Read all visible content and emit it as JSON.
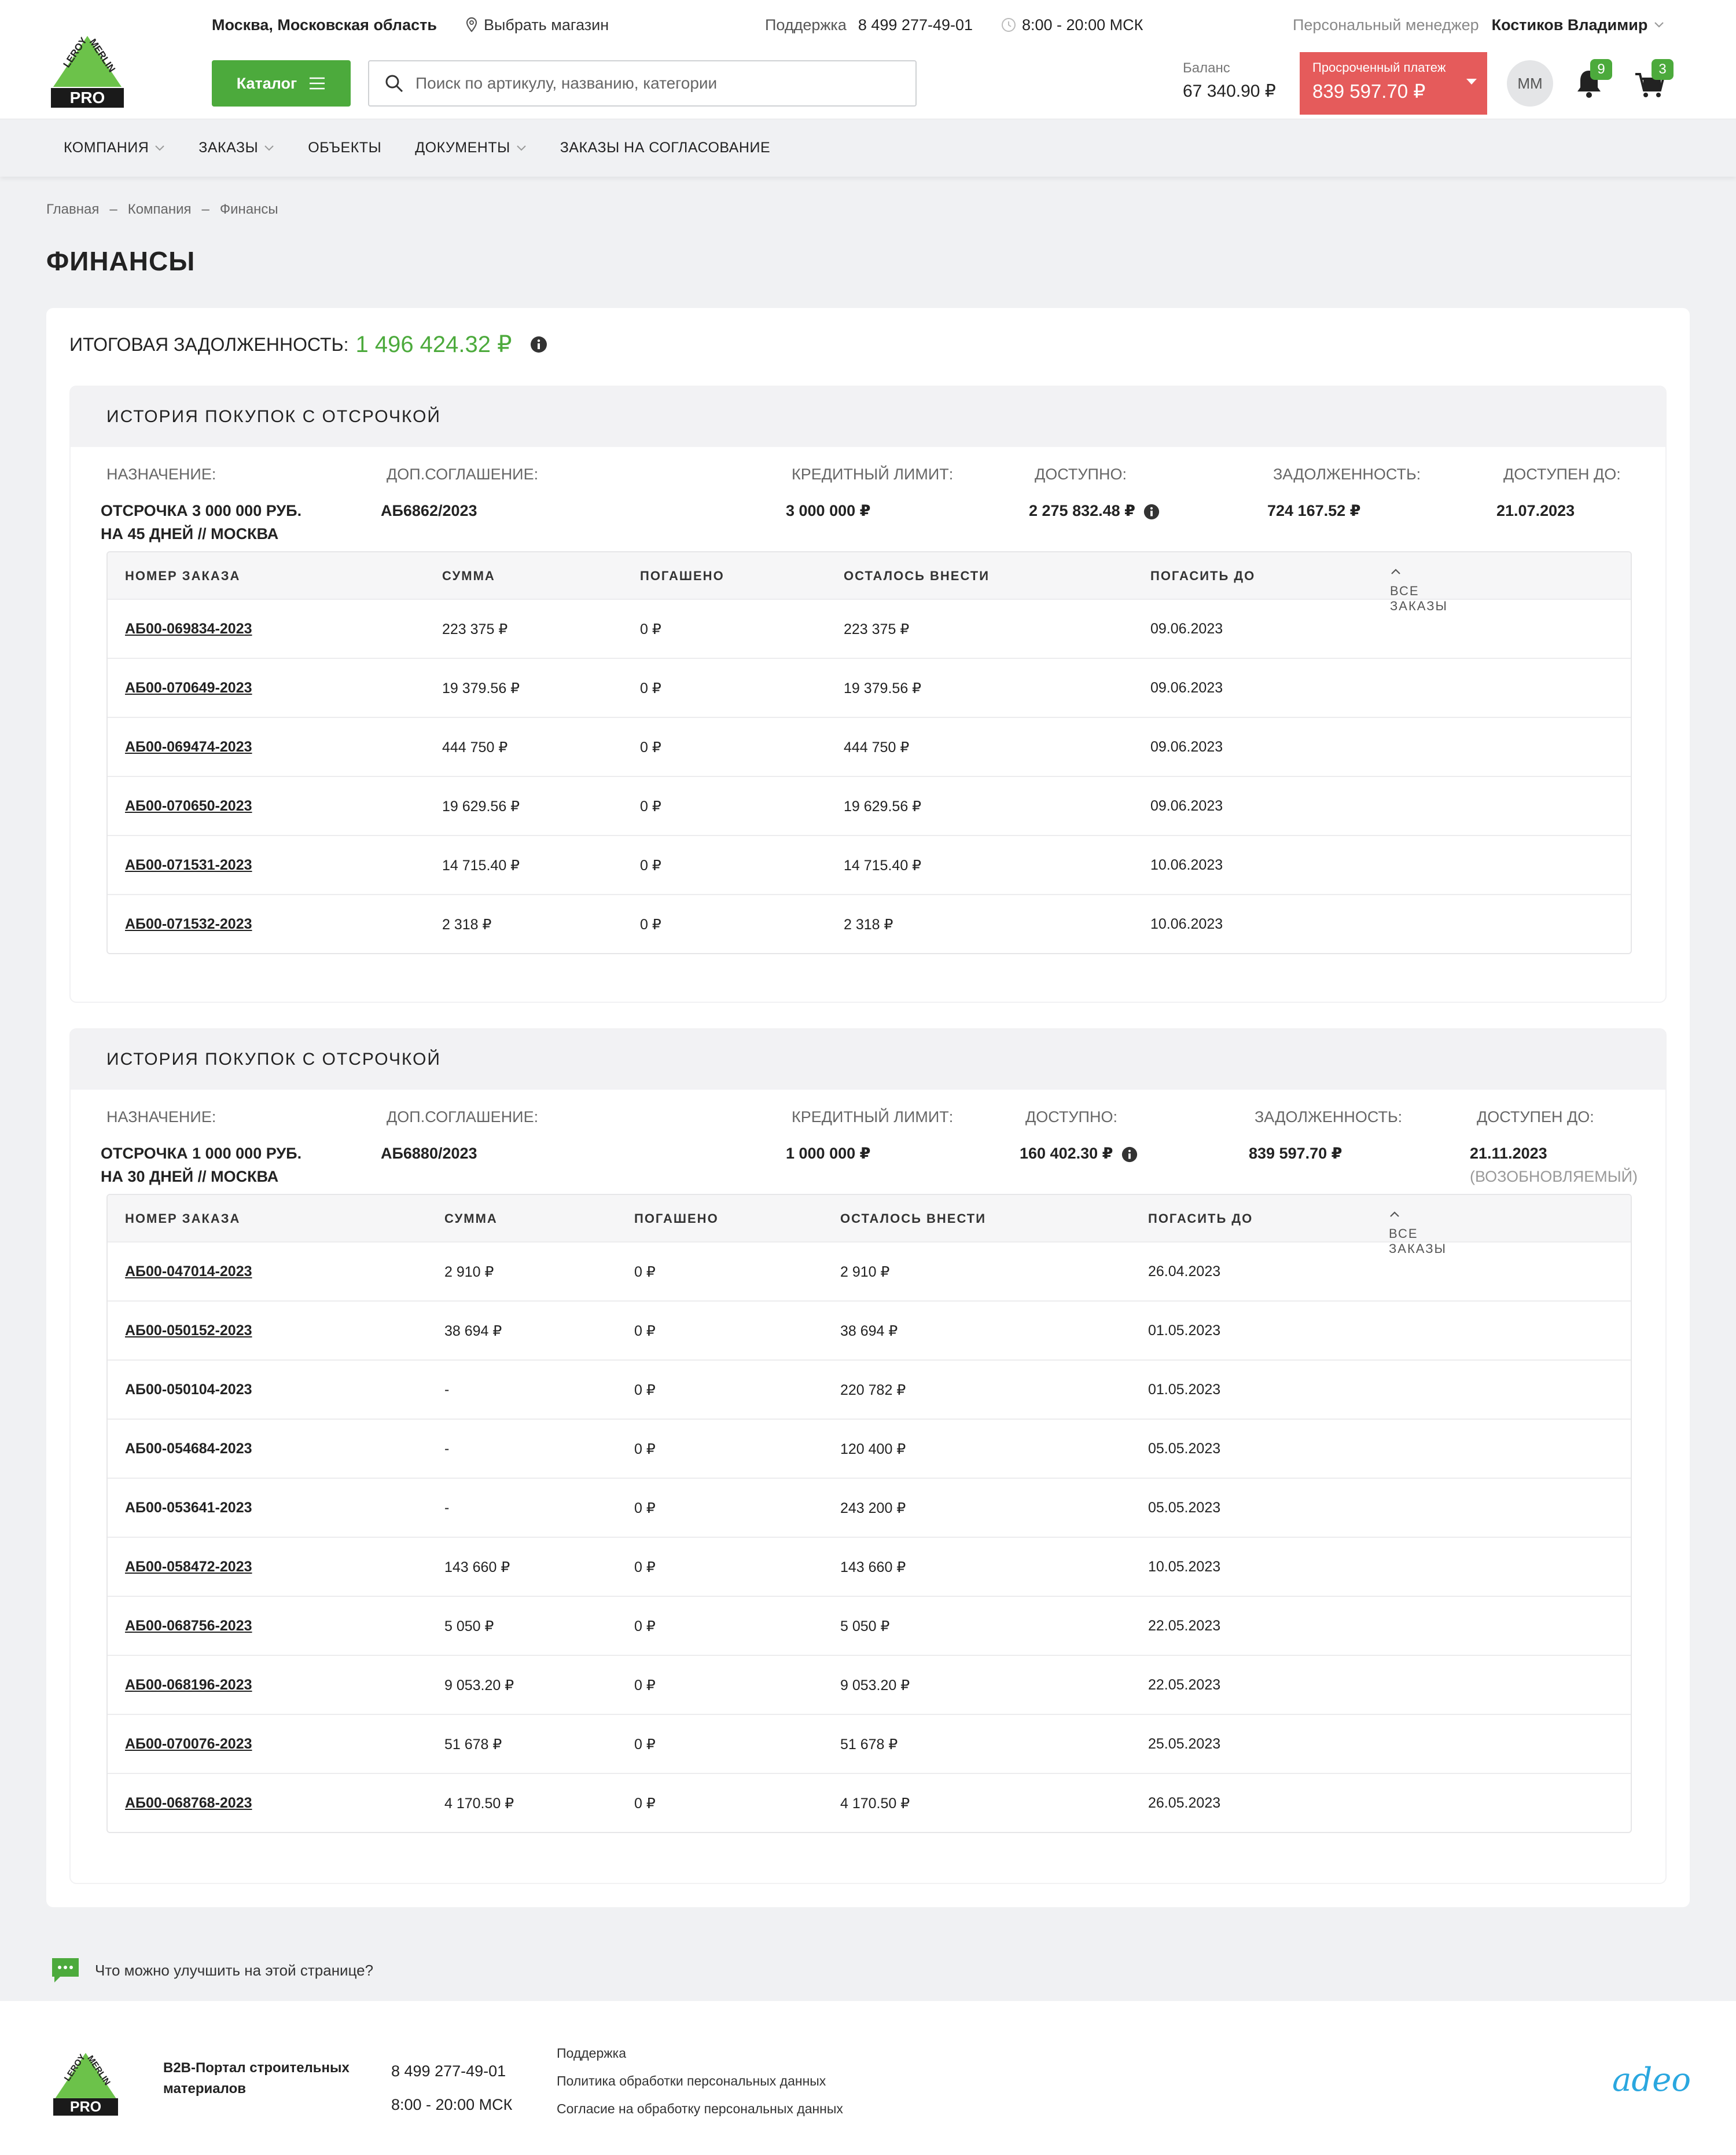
{
  "header": {
    "city": "Москва, Московская область",
    "store_label": "Выбрать магазин",
    "support_label": "Поддержка",
    "support_phone": "8 499 277-49-01",
    "hours": "8:00 - 20:00 МСК",
    "manager_label": "Персональный менеджер",
    "manager_name": "Костиков Владимир",
    "catalog_label": "Каталог",
    "search_placeholder": "Поиск по артикулу, названию, категории",
    "balance_label": "Баланс",
    "balance_value": "67 340.90 ₽",
    "overdue_label": "Просроченный платеж",
    "overdue_value": "839 597.70 ₽",
    "avatar_initials": "ММ",
    "notifications_count": "9",
    "cart_count": "3",
    "logo_text": "LEROY MERLIN",
    "logo_pro": "PRO"
  },
  "nav": {
    "items": [
      {
        "label": "КОМПАНИЯ"
      },
      {
        "label": "ЗАКАЗЫ"
      },
      {
        "label": "ОБЪЕКТЫ"
      },
      {
        "label": "ДОКУМЕНТЫ"
      },
      {
        "label": "ЗАКАЗЫ НА СОГЛАСОВАНИЕ"
      }
    ]
  },
  "breadcrumb": [
    "Главная",
    "Компания",
    "Финансы"
  ],
  "breadcrumb_sep": "–",
  "page_title": "ФИНАНСЫ",
  "total": {
    "label": "ИТОГОВАЯ ЗАДОЛЖЕННОСТЬ:",
    "amount": "1 496 424.32 ₽"
  },
  "labels": {
    "purpose": "НАЗНАЧЕНИЕ:",
    "agreement": "ДОП.СОГЛАШЕНИЕ:",
    "credit_limit": "КРЕДИТНЫЙ ЛИМИТ:",
    "available": "ДОСТУПНО:",
    "debt": "ЗАДОЛЖЕННОСТЬ:",
    "available_until": "ДОСТУПЕН ДО:",
    "col_order": "НОМЕР ЗАКАЗА",
    "col_sum": "СУММА",
    "col_paid": "ПОГАШЕНО",
    "col_remaining": "ОСТАЛОСЬ ВНЕСТИ",
    "col_due": "ПОГАСИТЬ ДО",
    "all_orders": "ВСЕ ЗАКАЗЫ"
  },
  "sections": [
    {
      "title": "ИСТОРИЯ ПОКУПОК С ОТСРОЧКОЙ",
      "purpose_line1": "ОТСРОЧКА 3 000 000 РУБ.",
      "purpose_line2": "НА 45 ДНЕЙ // МОСКВА",
      "agreement": "АБ6862/2023",
      "credit_limit": "3 000 000 ₽",
      "available": "2 275 832.48 ₽",
      "debt": "724 167.52 ₽",
      "available_until": "21.07.2023",
      "available_until_note": "",
      "orders": [
        {
          "num": "АБ00-069834-2023",
          "link": true,
          "sum": "223 375 ₽",
          "paid": "0 ₽",
          "remaining": "223 375 ₽",
          "due": "09.06.2023"
        },
        {
          "num": "АБ00-070649-2023",
          "link": true,
          "sum": "19 379.56 ₽",
          "paid": "0 ₽",
          "remaining": "19 379.56 ₽",
          "due": "09.06.2023"
        },
        {
          "num": "АБ00-069474-2023",
          "link": true,
          "sum": "444 750 ₽",
          "paid": "0 ₽",
          "remaining": "444 750 ₽",
          "due": "09.06.2023"
        },
        {
          "num": "АБ00-070650-2023",
          "link": true,
          "sum": "19 629.56 ₽",
          "paid": "0 ₽",
          "remaining": "19 629.56 ₽",
          "due": "09.06.2023"
        },
        {
          "num": "АБ00-071531-2023",
          "link": true,
          "sum": "14 715.40 ₽",
          "paid": "0 ₽",
          "remaining": "14 715.40 ₽",
          "due": "10.06.2023"
        },
        {
          "num": "АБ00-071532-2023",
          "link": true,
          "sum": "2 318 ₽",
          "paid": "0 ₽",
          "remaining": "2 318 ₽",
          "due": "10.06.2023"
        }
      ]
    },
    {
      "title": "ИСТОРИЯ ПОКУПОК С ОТСРОЧКОЙ",
      "purpose_line1": "ОТСРОЧКА 1 000 000 РУБ.",
      "purpose_line2": "НА 30 ДНЕЙ // МОСКВА",
      "agreement": "АБ6880/2023",
      "credit_limit": "1 000 000 ₽",
      "available": "160 402.30 ₽",
      "debt": "839 597.70 ₽",
      "available_until": "21.11.2023",
      "available_until_note": "(ВОЗОБНОВЛЯЕМЫЙ)",
      "orders": [
        {
          "num": "АБ00-047014-2023",
          "link": true,
          "sum": "2 910 ₽",
          "paid": "0 ₽",
          "remaining": "2 910 ₽",
          "due": "26.04.2023"
        },
        {
          "num": "АБ00-050152-2023",
          "link": true,
          "sum": "38 694 ₽",
          "paid": "0 ₽",
          "remaining": "38 694 ₽",
          "due": "01.05.2023"
        },
        {
          "num": "АБ00-050104-2023",
          "link": false,
          "sum": "-",
          "paid": "0 ₽",
          "remaining": "220 782 ₽",
          "due": "01.05.2023"
        },
        {
          "num": "АБ00-054684-2023",
          "link": false,
          "sum": "-",
          "paid": "0 ₽",
          "remaining": "120 400 ₽",
          "due": "05.05.2023"
        },
        {
          "num": "АБ00-053641-2023",
          "link": false,
          "sum": "-",
          "paid": "0 ₽",
          "remaining": "243 200 ₽",
          "due": "05.05.2023"
        },
        {
          "num": "АБ00-058472-2023",
          "link": true,
          "sum": "143 660 ₽",
          "paid": "0 ₽",
          "remaining": "143 660 ₽",
          "due": "10.05.2023"
        },
        {
          "num": "АБ00-068756-2023",
          "link": true,
          "sum": "5 050 ₽",
          "paid": "0 ₽",
          "remaining": "5 050 ₽",
          "due": "22.05.2023"
        },
        {
          "num": "АБ00-068196-2023",
          "link": true,
          "sum": "9 053.20 ₽",
          "paid": "0 ₽",
          "remaining": "9 053.20 ₽",
          "due": "22.05.2023"
        },
        {
          "num": "АБ00-070076-2023",
          "link": true,
          "sum": "51 678 ₽",
          "paid": "0 ₽",
          "remaining": "51 678 ₽",
          "due": "25.05.2023"
        },
        {
          "num": "АБ00-068768-2023",
          "link": true,
          "sum": "4 170.50 ₽",
          "paid": "0 ₽",
          "remaining": "4 170.50 ₽",
          "due": "26.05.2023"
        }
      ]
    }
  ],
  "feedback": "Что можно улучшить на этой странице?",
  "footer": {
    "title_line1": "B2B-Портал строительных",
    "title_line2": "материалов",
    "phone": "8 499 277-49-01",
    "hours": "8:00 - 20:00 МСК",
    "links": [
      "Поддержка",
      "Политика обработки персональных данных",
      "Согласие на обработку персональных данных"
    ],
    "brand": "adeo"
  },
  "colors": {
    "accent_green": "#4caa3c",
    "overdue_red": "#e55b5b",
    "brand_blue": "#2aa7df"
  }
}
